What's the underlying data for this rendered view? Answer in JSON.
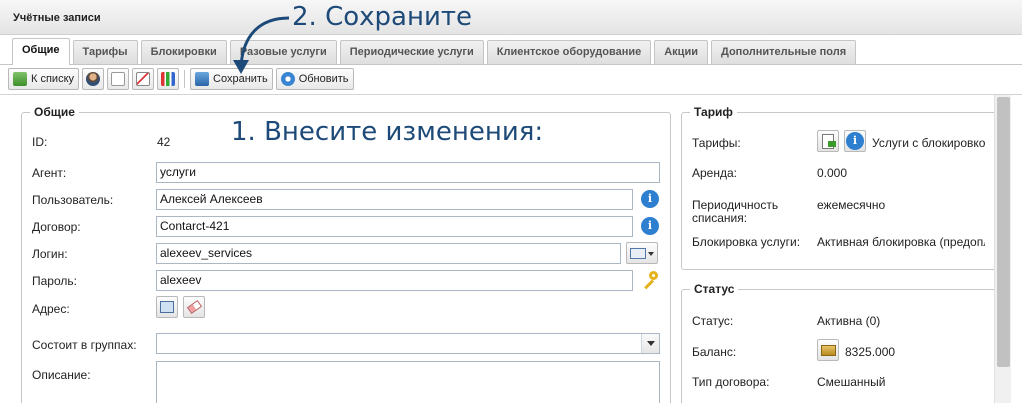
{
  "window": {
    "title": "Учётные записи"
  },
  "tabs": [
    {
      "label": "Общие",
      "active": true
    },
    {
      "label": "Тарифы"
    },
    {
      "label": "Блокировки"
    },
    {
      "label": "Разовые услуги"
    },
    {
      "label": "Периодические услуги"
    },
    {
      "label": "Клиентское оборудование"
    },
    {
      "label": "Акции"
    },
    {
      "label": "Дополнительные поля"
    }
  ],
  "toolbar": {
    "back_label": "К списку",
    "save_label": "Сохранить",
    "refresh_label": "Обновить"
  },
  "general": {
    "legend": "Общие",
    "id_label": "ID:",
    "id_value": "42",
    "agent_label": "Агент:",
    "agent_value": "услуги",
    "user_label": "Пользователь:",
    "user_value": "Алексей Алексеев",
    "contract_label": "Договор:",
    "contract_value": "Contarct-421",
    "login_label": "Логин:",
    "login_value": "alexeev_services",
    "password_label": "Пароль:",
    "password_value": "alexeev",
    "address_label": "Адрес:",
    "groups_label": "Состоит в группах:",
    "groups_value": "",
    "description_label": "Описание:",
    "description_value": ""
  },
  "tariff": {
    "legend": "Тариф",
    "tariffs_label": "Тарифы:",
    "tariffs_value": "Услуги с блокировко",
    "rent_label": "Аренда:",
    "rent_value": "0.000",
    "period_label_1": "Периодичность",
    "period_label_2": "списания:",
    "period_value": "ежемесячно",
    "block_label": "Блокировка услуги:",
    "block_value": "Активная блокировка (предопл"
  },
  "status": {
    "legend": "Статус",
    "status_label": "Статус:",
    "status_value": "Активна (0)",
    "balance_label": "Баланс:",
    "balance_value": "8325.000",
    "contract_type_label": "Тип договора:",
    "contract_type_value": "Смешанный"
  },
  "annotations": {
    "step1": "1. Внесите изменения:",
    "step2": "2. Сохраните"
  },
  "colors": {
    "annotation": "#1d4a78",
    "info_icon": "#2f7fd0"
  }
}
